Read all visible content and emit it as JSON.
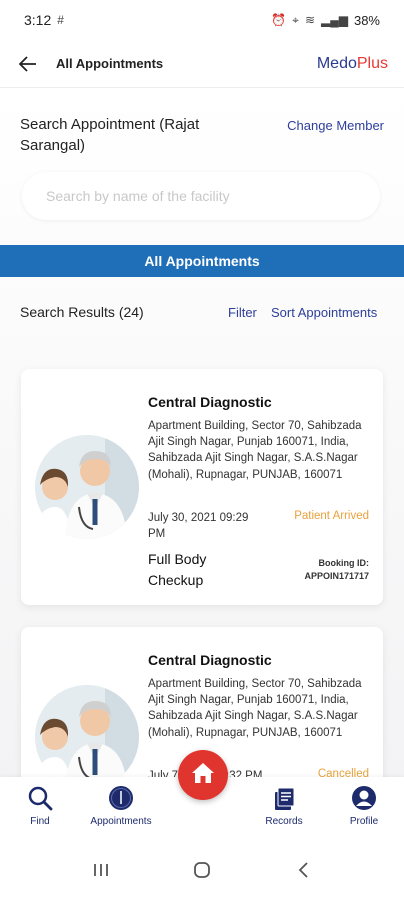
{
  "status_bar": {
    "time": "3:12",
    "battery": "38%"
  },
  "app_bar": {
    "title": "All Appointments",
    "brand_part1": "Medo",
    "brand_part2": "Plus"
  },
  "search": {
    "title": "Search Appointment (Rajat Sarangal)",
    "change_member": "Change Member",
    "placeholder": "Search by name of the facility"
  },
  "tab": {
    "label": "All Appointments"
  },
  "results": {
    "label": "Search Results (24)",
    "filter": "Filter",
    "sort": "Sort Appointments"
  },
  "appointments": [
    {
      "facility": "Central Diagnostic",
      "address": "Apartment Building, Sector 70, Sahibzada Ajit Singh Nagar, Punjab 160071, India, Sahibzada Ajit Singh Nagar, S.A.S.Nagar (Mohali), Rupnagar, PUNJAB, 160071",
      "datetime": "July 30, 2021 09:29 PM",
      "status": "Patient Arrived",
      "test": "Full Body Checkup",
      "booking_label": "Booking ID:",
      "booking_id": "APPOIN171717"
    },
    {
      "facility": "Central Diagnostic",
      "address": "Apartment Building, Sector 70, Sahibzada Ajit Singh Nagar, Punjab 160071, India, Sahibzada Ajit Singh Nagar, S.A.S.Nagar (Mohali), Rupnagar, PUNJAB, 160071",
      "datetime": "July 7, 2021 05:32 PM",
      "status": "Cancelled"
    }
  ],
  "bottom_nav": {
    "find": "Find",
    "appointments": "Appointments",
    "records": "Records",
    "profile": "Profile"
  },
  "colors": {
    "primary": "#1d2a6b",
    "tab_blue": "#1f6fb8",
    "accent_red": "#e0342f",
    "status_orange": "#e8a23c"
  }
}
